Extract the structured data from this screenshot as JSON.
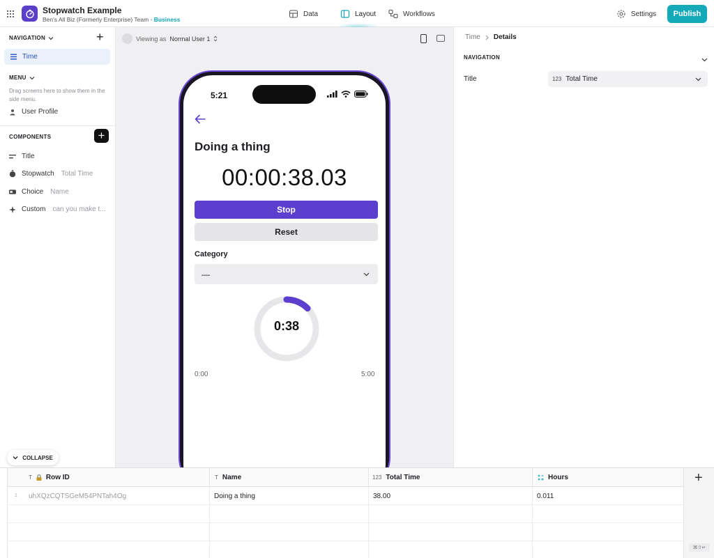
{
  "app": {
    "title": "Stopwatch Example",
    "team": "Ben's All Biz (Formerly Enterprise) Team -",
    "plan": "Business"
  },
  "topnav": {
    "tabs": [
      {
        "label": "Data",
        "icon": "table-icon"
      },
      {
        "label": "Layout",
        "icon": "layout-icon",
        "active": true
      },
      {
        "label": "Workflows",
        "icon": "workflow-icon"
      }
    ],
    "settings_label": "Settings",
    "publish_label": "Publish",
    "accent_color": "#13a9b9"
  },
  "sidebar": {
    "navigation_header": "NAVIGATION",
    "nav_items": [
      {
        "label": "Time"
      }
    ],
    "menu_header": "MENU",
    "menu_hint": "Drag screens here to show them in the side menu.",
    "menu_items": [
      {
        "label": "User Profile"
      }
    ],
    "components_header": "COMPONENTS",
    "components": [
      {
        "label": "Title",
        "sub": "",
        "icon": "title-icon"
      },
      {
        "label": "Stopwatch",
        "sub": "Total Time",
        "icon": "stopwatch-icon"
      },
      {
        "label": "Choice",
        "sub": "Name",
        "icon": "choice-icon"
      },
      {
        "label": "Custom",
        "sub": "can you make t...",
        "icon": "sparkle-icon"
      }
    ],
    "collapse_label": "COLLAPSE"
  },
  "canvas": {
    "viewing_prefix": "Viewing as",
    "viewing_user": "Normal User 1",
    "phone": {
      "status_time": "5:21",
      "screen_title": "Doing a thing",
      "timer": "00:00:38.03",
      "stop_label": "Stop",
      "reset_label": "Reset",
      "category_label": "Category",
      "category_value": "—",
      "ring_label": "0:38",
      "ring_progress": 0.1267,
      "range_min": "0:00",
      "range_max": "5:00",
      "accent_color": "#5d3fcf"
    }
  },
  "right_panel": {
    "breadcrumb_parent": "Time",
    "breadcrumb_current": "Details",
    "section_header": "NAVIGATION",
    "field_label": "Title",
    "field_type_badge": "123",
    "field_value": "Total Time"
  },
  "table": {
    "columns": [
      {
        "label": "Row ID",
        "type": "T",
        "icon": "lock-icon"
      },
      {
        "label": "Name",
        "type": "T"
      },
      {
        "label": "Total Time",
        "type": "123"
      },
      {
        "label": "Hours",
        "type": "math"
      }
    ],
    "rows": [
      {
        "num": "1",
        "row_id": "uhXQzCQTSGeM54PNTah4Og",
        "name": "Doing a thing",
        "total_time": "38.00",
        "hours": "0.011"
      }
    ],
    "shortcut_hint": "⌘⇧↵"
  }
}
